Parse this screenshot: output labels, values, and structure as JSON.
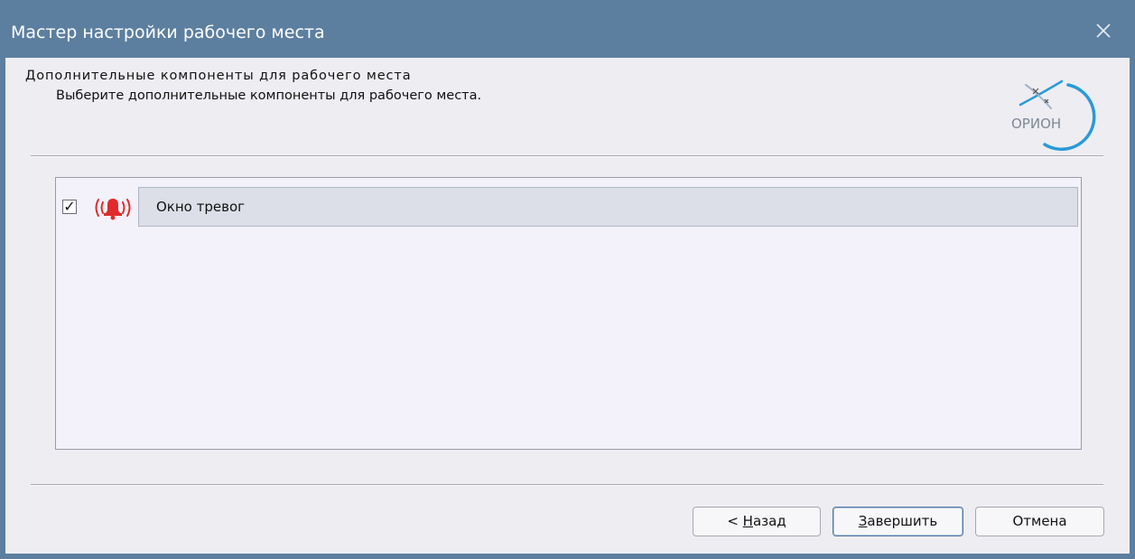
{
  "window": {
    "title": "Мастер настройки рабочего места",
    "close_icon": "close-icon"
  },
  "header": {
    "title": "Дополнительные компоненты для рабочего места",
    "subtitle": "Выберите дополнительные компоненты для рабочего места.",
    "logo_text": "ОРИОН"
  },
  "components": [
    {
      "label": "Окно тревог",
      "checked": true,
      "checkmark": "✓",
      "icon": "alarm-bell-icon"
    }
  ],
  "buttons": {
    "back": {
      "prefix": "< ",
      "mnemonic": "Н",
      "rest": "азад"
    },
    "finish": {
      "mnemonic": "З",
      "rest": "авершить"
    },
    "cancel": {
      "label": "Отмена"
    }
  },
  "colors": {
    "titlebar": "#5c7fa0",
    "dialog_bg": "#eeedf2",
    "alarm_red": "#e02b2b",
    "logo_blue": "#2a9ad6"
  }
}
